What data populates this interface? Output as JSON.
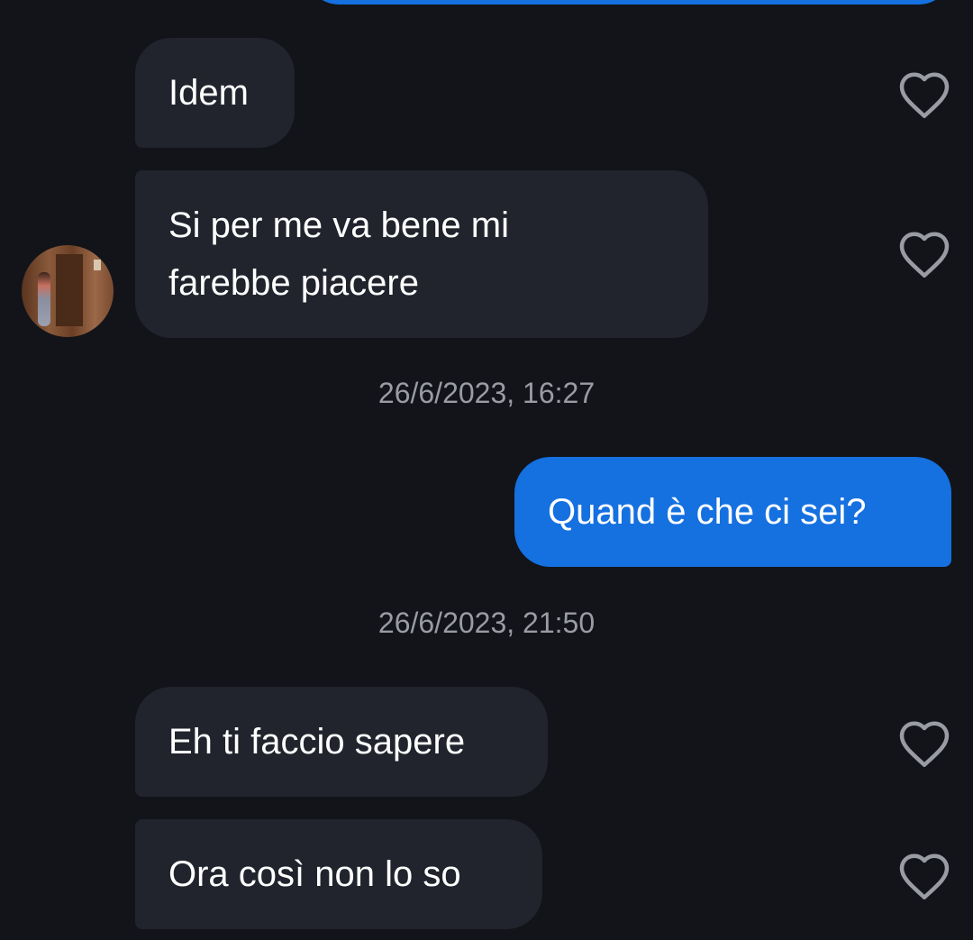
{
  "conversation": {
    "messages": [
      {
        "direction": "in",
        "text": "Idem"
      },
      {
        "direction": "in",
        "text": "Si per me va bene mi\nfarebbe piacere"
      },
      {
        "direction": "out",
        "text": "Quand è che ci sei?"
      },
      {
        "direction": "in",
        "text": "Eh ti faccio sapere"
      },
      {
        "direction": "in",
        "text": "Ora così non lo so"
      }
    ],
    "timestamps": [
      "26/6/2023, 16:27",
      "26/6/2023, 21:50"
    ]
  },
  "icons": {
    "like": "heart-outline-icon",
    "avatar": "contact-avatar"
  },
  "colors": {
    "background": "#121419",
    "incoming_bubble": "#21242d",
    "outgoing_bubble": "#1570e0",
    "timestamp_text": "#9a9ca3",
    "heart_outline": "#9a9ca3"
  }
}
